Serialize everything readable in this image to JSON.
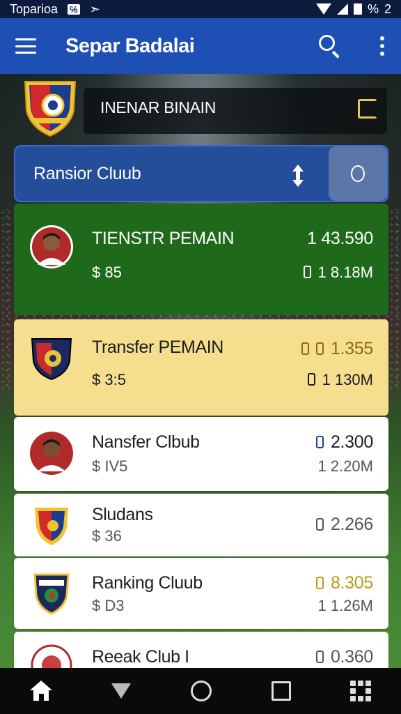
{
  "status_bar": {
    "carrier": "Toparioa",
    "box_label": "℅",
    "arrows": "➣",
    "percent_label": "%",
    "battery_num": "2"
  },
  "app_bar": {
    "title": "Separ Badalai"
  },
  "header": {
    "title": "INENAR BINAIN"
  },
  "club_banner": {
    "name": "Ransior Cluub",
    "button_label": "0"
  },
  "rows": [
    {
      "title": "TIENSTR PEMAIN",
      "sub": "85",
      "value_top": "1  43.590",
      "value_bottom": "1   8.18M",
      "style": "green"
    },
    {
      "title": "Transfer PEMAIN",
      "sub": "3:5",
      "value_top": "1.355",
      "value_bottom": "1   130M",
      "style": "yellow"
    },
    {
      "title": "Nansfer Clbub",
      "sub": "IV5",
      "value_top": "2.300",
      "value_bottom": "1 2.20M",
      "style": "white"
    },
    {
      "title": "Sludans",
      "sub": "36",
      "value_top": "2.266",
      "value_bottom": "",
      "style": "white"
    },
    {
      "title": "Ranking Cluub",
      "sub": "D3",
      "value_top": "8.305",
      "value_bottom": "1 1.26M",
      "style": "white"
    },
    {
      "title": "Reeak Club I",
      "sub": "",
      "value_top": "0.360",
      "value_bottom": "",
      "style": "white"
    }
  ],
  "colors": {
    "app_bar": "#1e4fb4",
    "green_row": "#1f6a1a",
    "yellow_row": "#f5df8f",
    "gold_value": "#b79b17"
  },
  "icons": [
    "menu-icon",
    "search-icon",
    "more-vert-icon",
    "sort-icon",
    "coin-icon",
    "home-icon",
    "back-icon",
    "circle-home-icon",
    "recent-apps-icon",
    "grid-icon"
  ]
}
